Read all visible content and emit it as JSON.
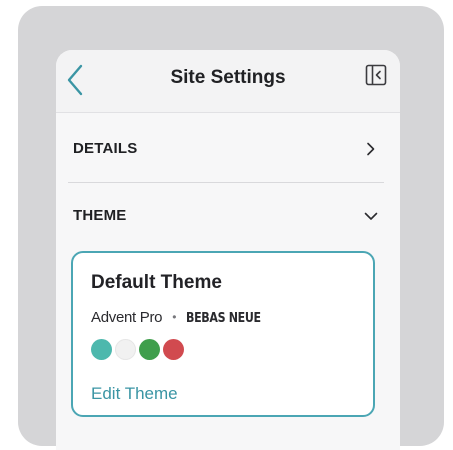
{
  "header": {
    "title": "Site Settings"
  },
  "sections": [
    {
      "label": "DETAILS",
      "state": "collapsed"
    },
    {
      "label": "THEME",
      "state": "expanded"
    }
  ],
  "theme": {
    "name": "Default Theme",
    "primary_font": "Advent Pro",
    "separator": "•",
    "secondary_font": "BEBAS NEUE",
    "swatches": [
      "#4db8ad",
      "#f1f1f1",
      "#3f9e4c",
      "#d14a4f"
    ],
    "edit_label": "Edit Theme"
  },
  "colors": {
    "accent": "#4ba6b4",
    "link": "#3a95a4"
  }
}
